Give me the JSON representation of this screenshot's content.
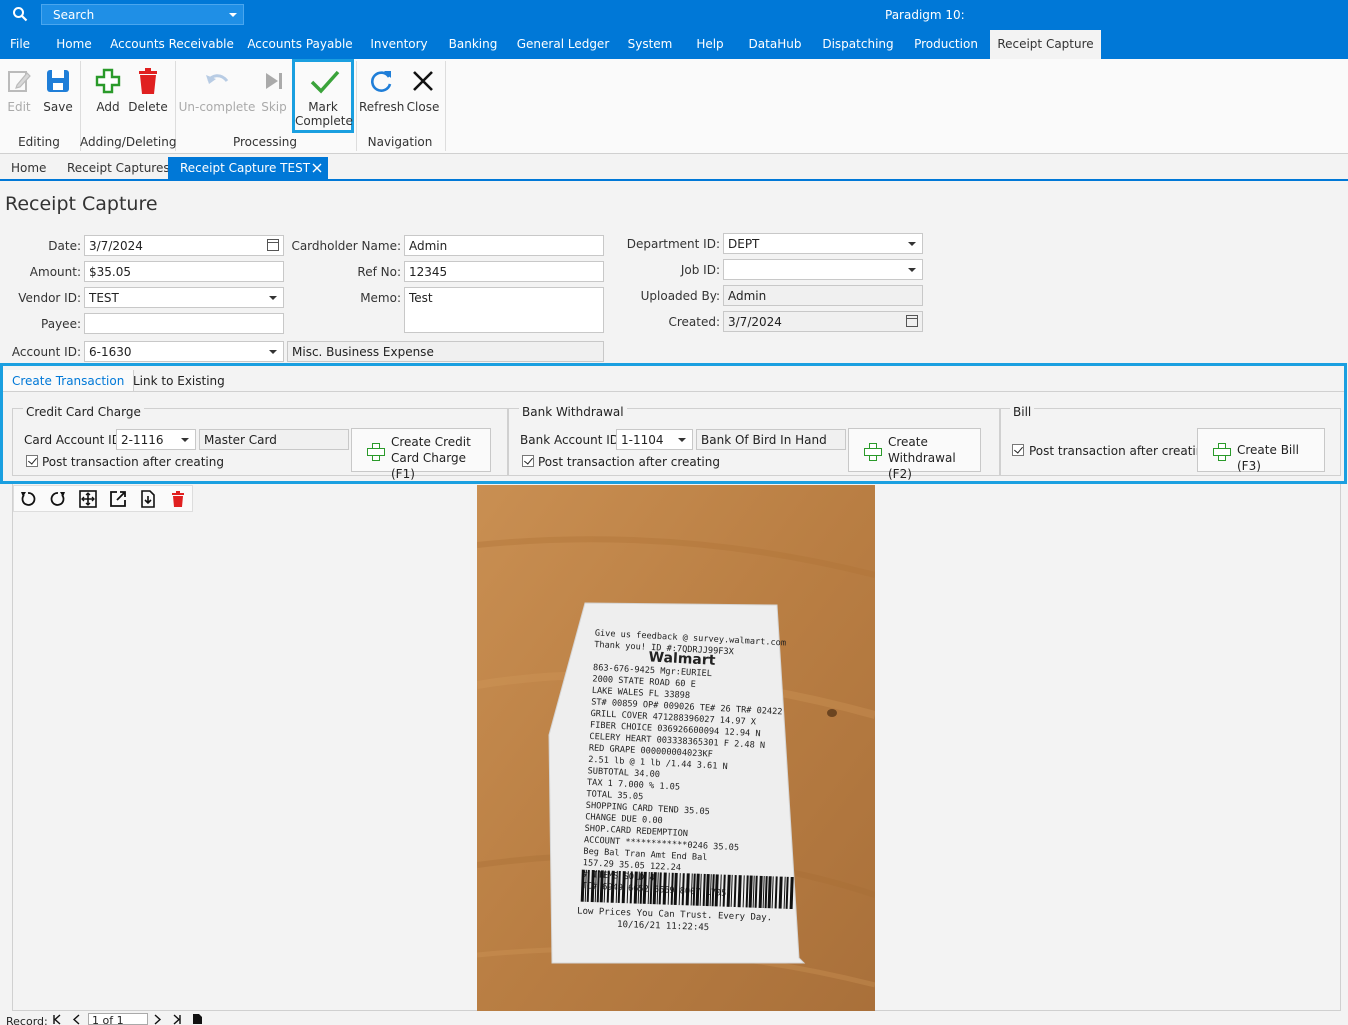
{
  "search": {
    "placeholder": "Search"
  },
  "app_title": "Paradigm 10:",
  "menu": [
    "File",
    "Home",
    "Accounts Receivable",
    "Accounts Payable",
    "Inventory",
    "Banking",
    "General Ledger",
    "System",
    "Help",
    "DataHub",
    "Dispatching",
    "Production",
    "Receipt Capture"
  ],
  "ribbon": {
    "edit": "Edit",
    "save": "Save",
    "add": "Add",
    "delete": "Delete",
    "uncomplete": "Un-complete",
    "skip": "Skip",
    "mark": "Mark",
    "complete": "Complete",
    "refresh": "Refresh",
    "close": "Close",
    "groups": {
      "editing": "Editing",
      "adding": "Adding/Deleting",
      "processing": "Processing",
      "navigation": "Navigation"
    }
  },
  "doctabs": [
    "Home",
    "Receipt Captures",
    "Receipt Capture TEST"
  ],
  "page_title": "Receipt Capture",
  "form": {
    "date_label": "Date:",
    "date": "3/7/2024",
    "amount_label": "Amount:",
    "amount": "$35.05",
    "vendor_label": "Vendor ID:",
    "vendor": "TEST",
    "payee_label": "Payee:",
    "payee": "",
    "account_label": "Account ID:",
    "account": "6-1630",
    "account_desc": "Misc. Business Expense",
    "cardholder_label": "Cardholder Name:",
    "cardholder": "Admin",
    "refno_label": "Ref No:",
    "refno": "12345",
    "memo_label": "Memo:",
    "memo": "Test",
    "dept_label": "Department ID:",
    "dept": "DEPT",
    "job_label": "Job ID:",
    "job": "",
    "uploaded_label": "Uploaded By:",
    "uploaded": "Admin",
    "created_label": "Created:",
    "created": "3/7/2024"
  },
  "transaction": {
    "tab_create": "Create Transaction",
    "tab_link": "Link to Existing",
    "cc_title": "Credit Card Charge",
    "cc_acct_label": "Card Account ID:",
    "cc_acct": "2-1116",
    "cc_acct_desc": "Master Card",
    "cc_post": "Post transaction after creating",
    "cc_btn_1": "Create Credit",
    "cc_btn_2": "Card Charge (F1)",
    "bw_title": "Bank Withdrawal",
    "bw_acct_label": "Bank Account ID:",
    "bw_acct": "1-1104",
    "bw_acct_desc": "Bank Of Bird In Hand",
    "bw_post": "Post transaction after creating",
    "bw_btn_1": "Create",
    "bw_btn_2": "Withdrawal (F2)",
    "bill_title": "Bill",
    "bill_post": "Post transaction after creating",
    "bill_btn": "Create Bill (F3)"
  },
  "receipt": {
    "lines": [
      "Give us feedback @ survey.walmart.com",
      "Thank you! ID #:7QDRJJ99F3X",
      "Walmart",
      "863-676-9425 Mgr:EURIEL",
      "2000 STATE ROAD 60 E",
      "LAKE WALES FL 33898",
      "ST# 00859 OP# 009026 TE# 26 TR# 02422",
      "GRILL COVER  471288396027   14.97 X",
      "FIBER CHOICE 036926600094   12.94 N",
      "CELERY HEART 003338365301 F  2.48 N",
      "RED GRAPE    000000004023KF",
      "  2.51 lb @ 1 lb /1.44      3.61 N",
      "             SUBTOTAL      34.00",
      "   TAX 1   7.000 %          1.05",
      "             TOTAL         35.05",
      "  SHOPPING CARD TEND        35.05",
      "          CHANGE DUE        0.00",
      "SHOP.CARD REDEMPTION",
      "ACCOUNT ************0246   35.05",
      "Beg Bal    Tran Amt   End Bal",
      "157.29       35.05    122.24",
      "        # ITEMS SOLD 4",
      "   TC# 6949 6652 6669 8007 1705"
    ],
    "footer1": "Low Prices You Can Trust. Every Day.",
    "footer2": "10/16/21        11:22:45"
  },
  "recnav": {
    "label": "Record:",
    "pos": "1 of 1"
  },
  "colors": {
    "accent": "#0078d7",
    "highlight": "#1a9fe0",
    "green": "#2a9a2a",
    "red": "#e02020"
  }
}
